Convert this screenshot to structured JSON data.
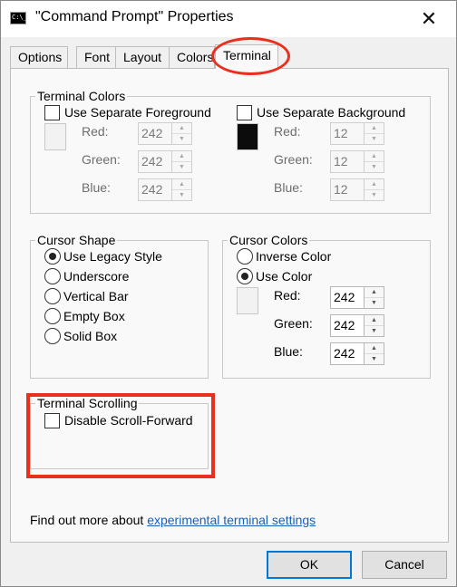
{
  "window": {
    "title": "\"Command Prompt\" Properties",
    "close_glyph": "✕",
    "app_icon_text": "C:\\_"
  },
  "tabs": [
    {
      "label": "Options",
      "active": false
    },
    {
      "label": "Font",
      "active": false
    },
    {
      "label": "Layout",
      "active": false
    },
    {
      "label": "Colors",
      "active": false
    },
    {
      "label": "Terminal",
      "active": true
    }
  ],
  "terminal_colors": {
    "legend": "Terminal Colors",
    "foreground": {
      "checkbox_label": "Use Separate Foreground",
      "checked": false,
      "swatch_color": "#f2f2f2",
      "red_label": "Red:",
      "red": "242",
      "green_label": "Green:",
      "green": "242",
      "blue_label": "Blue:",
      "blue": "242"
    },
    "background": {
      "checkbox_label": "Use Separate Background",
      "checked": false,
      "swatch_color": "#0c0c0c",
      "red_label": "Red:",
      "red": "12",
      "green_label": "Green:",
      "green": "12",
      "blue_label": "Blue:",
      "blue": "12"
    }
  },
  "cursor_shape": {
    "legend": "Cursor Shape",
    "options": [
      {
        "label": "Use Legacy Style",
        "selected": true
      },
      {
        "label": "Underscore",
        "selected": false
      },
      {
        "label": "Vertical Bar",
        "selected": false
      },
      {
        "label": "Empty Box",
        "selected": false
      },
      {
        "label": "Solid Box",
        "selected": false
      }
    ]
  },
  "cursor_colors": {
    "legend": "Cursor Colors",
    "inverse_label": "Inverse Color",
    "inverse_selected": false,
    "use_color_label": "Use Color",
    "use_color_selected": true,
    "swatch_color": "#f2f2f2",
    "red_label": "Red:",
    "red": "242",
    "green_label": "Green:",
    "green": "242",
    "blue_label": "Blue:",
    "blue": "242"
  },
  "terminal_scrolling": {
    "legend": "Terminal Scrolling",
    "checkbox_label": "Disable Scroll-Forward",
    "checked": false
  },
  "info": {
    "prefix": "Find out more about ",
    "link_text": "experimental terminal settings"
  },
  "buttons": {
    "ok": "OK",
    "cancel": "Cancel"
  },
  "colors": {
    "highlight_red": "#ea2f1f",
    "link_blue": "#1a5fb4",
    "default_button_border": "#0078d7"
  }
}
